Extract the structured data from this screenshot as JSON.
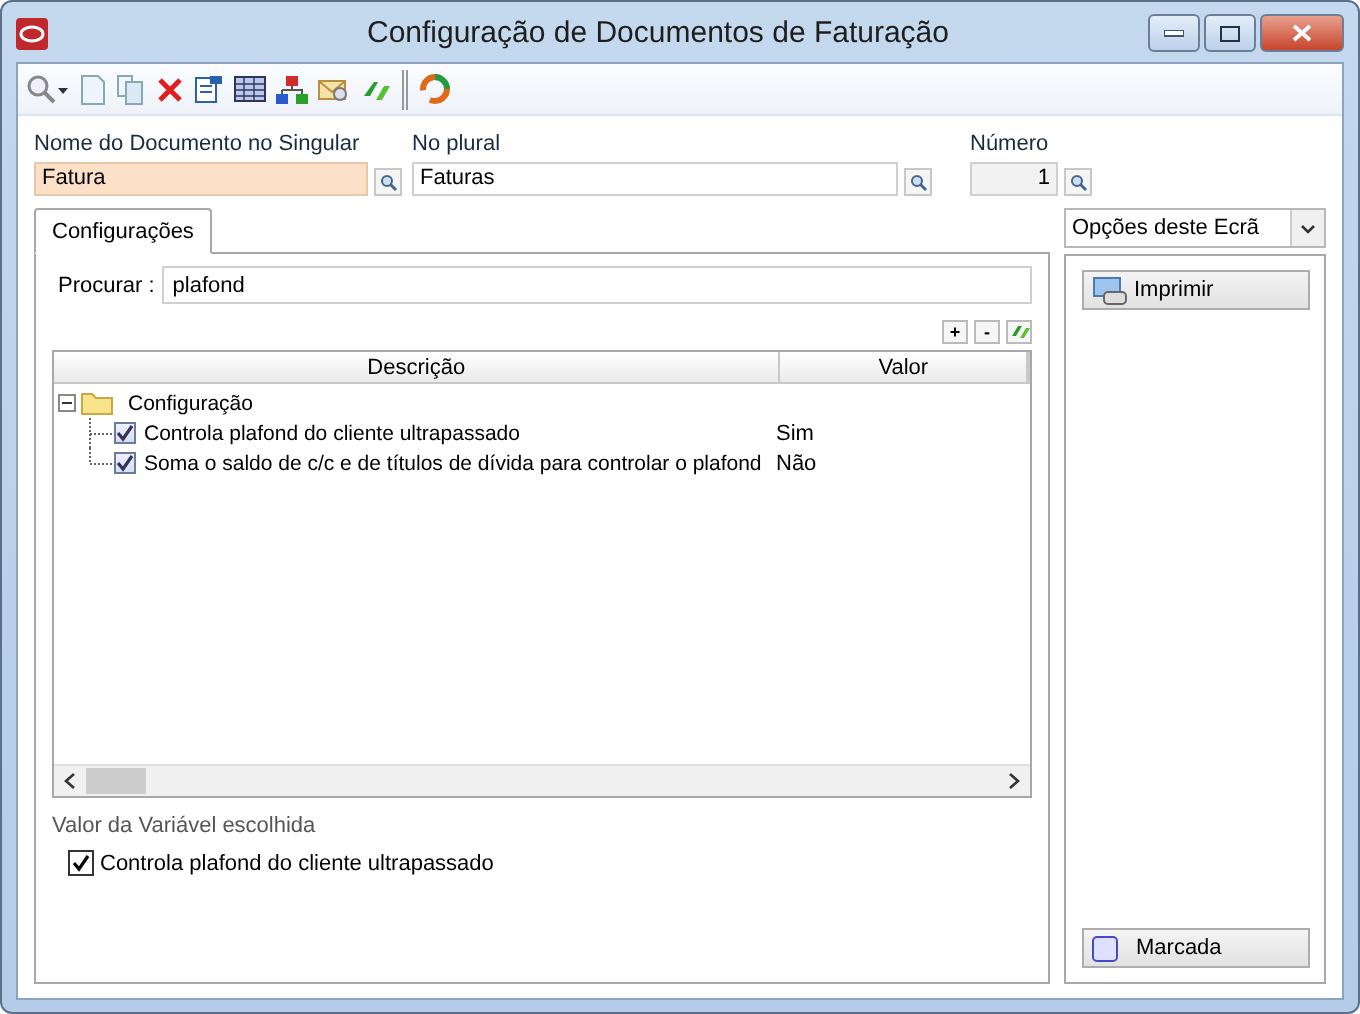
{
  "window": {
    "title": "Configuração de Documentos de Faturação"
  },
  "fields": [
    {
      "label": "Nome do Documento no Singular",
      "value": "Fatura",
      "focused": true,
      "disabled": false
    },
    {
      "label": "No plural",
      "value": "Faturas",
      "focused": false,
      "disabled": false
    },
    {
      "label": "Número",
      "value": "1",
      "focused": false,
      "disabled": true
    }
  ],
  "tabs": [
    {
      "label": "Configurações",
      "selected": true
    }
  ],
  "search": {
    "label": "Procurar :",
    "value": "plafond"
  },
  "tree_buttons": [
    "+",
    "-"
  ],
  "table": {
    "columns": [
      "Descrição",
      "Valor"
    ],
    "tree": [
      {
        "label": "Configuração",
        "expanded": true,
        "children": [
          {
            "label": "Controla plafond do cliente ultrapassado",
            "value": "Sim",
            "checked": true
          },
          {
            "label": "Soma o saldo de c/c e de títulos de dívida para controlar o plafond",
            "value": "Não",
            "checked": true
          }
        ]
      }
    ]
  },
  "chosen": {
    "title": "Valor da Variável escolhida",
    "label": "Controla plafond do cliente ultrapassado",
    "checked": true
  },
  "side": {
    "dropdown": "Opções deste Ecrã",
    "buttons": [
      {
        "label": "Imprimir",
        "kind": "print"
      },
      {
        "label": "Marcada",
        "kind": "mark"
      }
    ]
  }
}
